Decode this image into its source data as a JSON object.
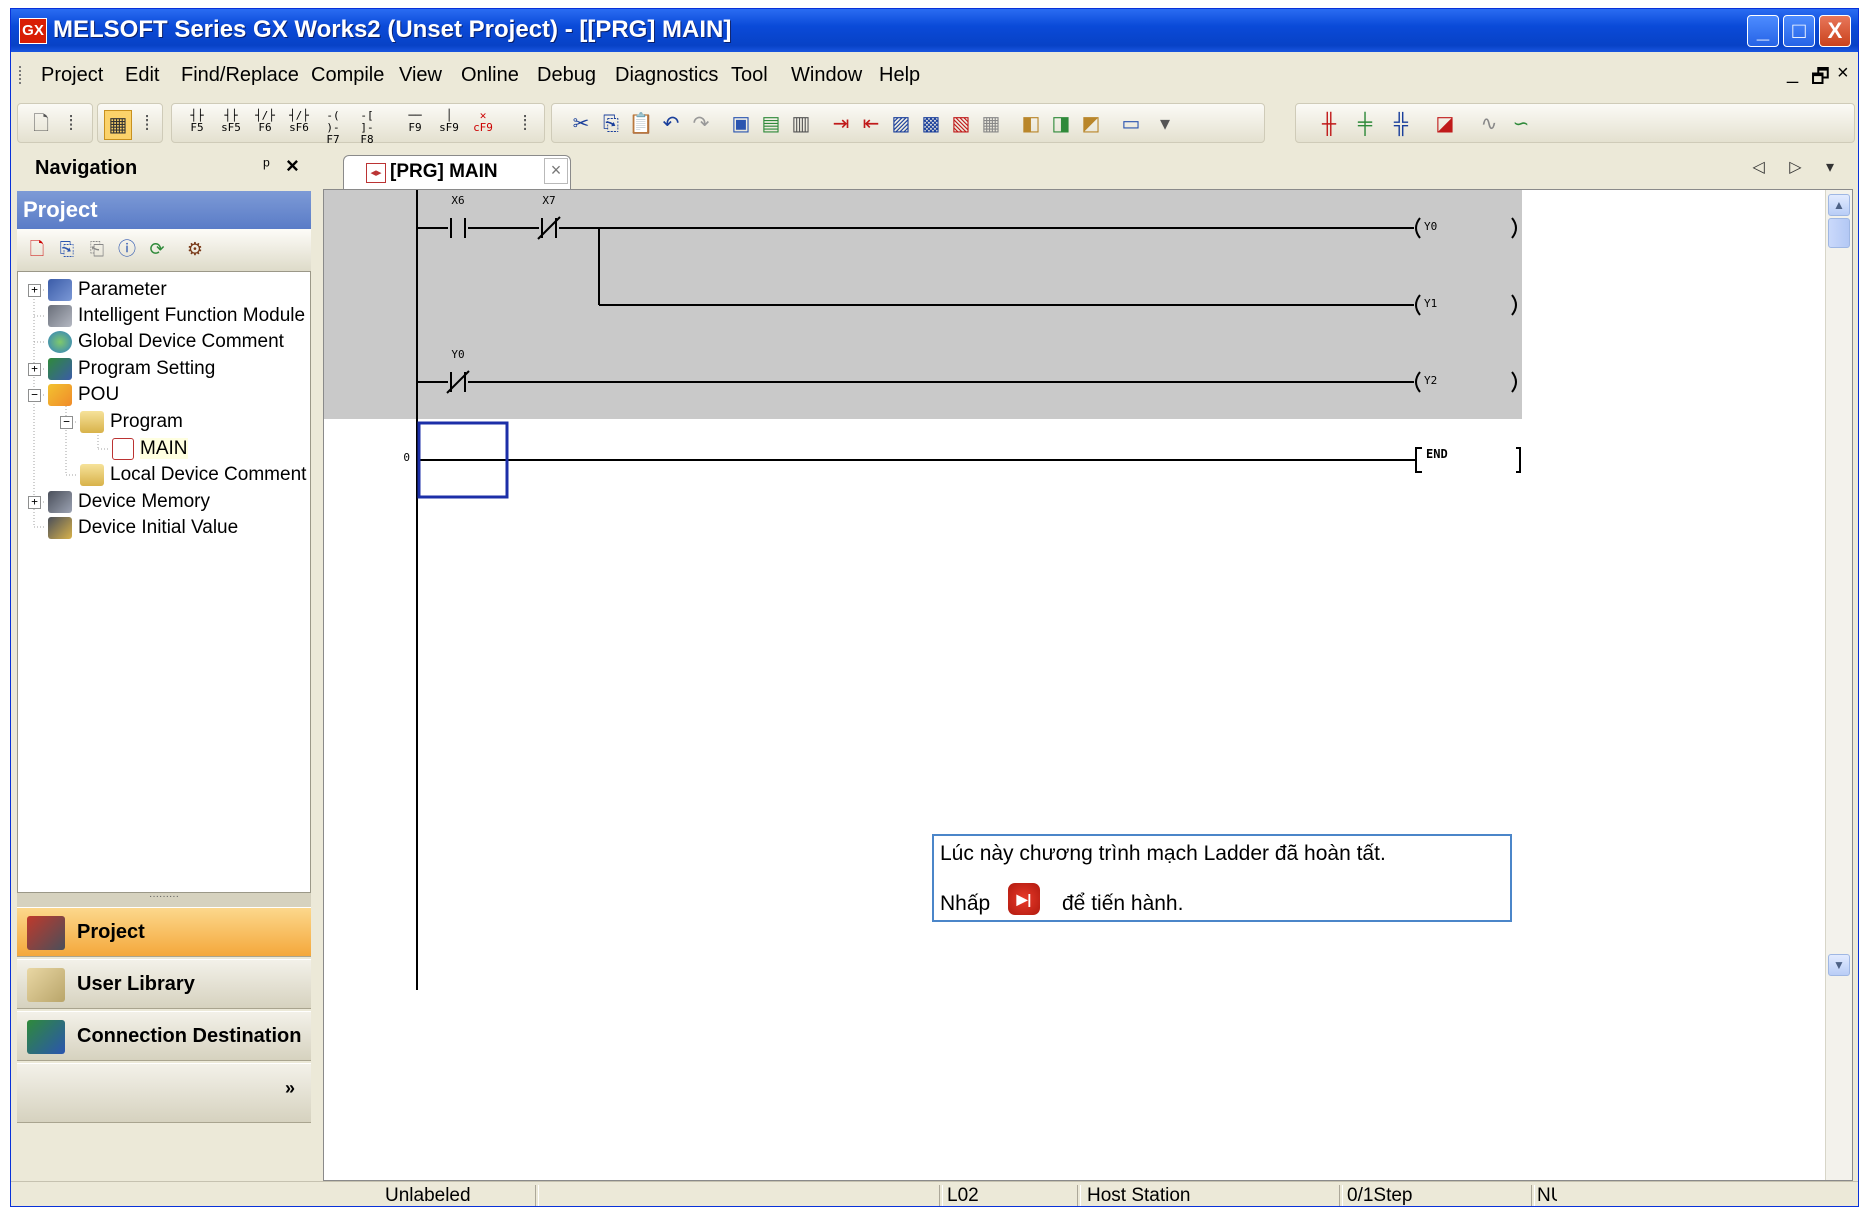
{
  "window": {
    "title": "MELSOFT Series GX Works2 (Unset Project) - [[PRG] MAIN]",
    "app_icon_text": "GX",
    "buttons": {
      "minimize": "_",
      "maximize": "□",
      "close": "X"
    }
  },
  "menu": {
    "items": [
      "Project",
      "Edit",
      "Find/Replace",
      "Compile",
      "View",
      "Online",
      "Debug",
      "Diagnostics",
      "Tool",
      "Window",
      "Help"
    ],
    "mdi": {
      "minimize": "_",
      "restore": "🗗",
      "close": "×"
    }
  },
  "toolbar": {
    "ladder_symbols": [
      "F5",
      "sF5",
      "F6",
      "sF6",
      "F7",
      "F8",
      "F9",
      "sF9",
      "cF9"
    ]
  },
  "navigation": {
    "title": "Navigation",
    "pin": "ᵖ",
    "close": "×",
    "project_header": "Project",
    "tree": [
      {
        "label": "Parameter",
        "expander": "+"
      },
      {
        "label": "Intelligent Function Module"
      },
      {
        "label": "Global Device Comment"
      },
      {
        "label": "Program Setting",
        "expander": "+"
      },
      {
        "label": "POU",
        "expander": "−"
      },
      {
        "label": "Program",
        "expander": "−"
      },
      {
        "label": "MAIN"
      },
      {
        "label": "Local Device Comment"
      },
      {
        "label": "Device Memory",
        "expander": "+"
      },
      {
        "label": "Device Initial Value"
      }
    ],
    "tabs": [
      {
        "label": "Project"
      },
      {
        "label": "User Library"
      },
      {
        "label": "Connection Destination"
      }
    ],
    "more": "»"
  },
  "editor": {
    "tab_label": "[PRG] MAIN",
    "tab_icon": "◂▸",
    "tab_close": "×",
    "tab_nav": "◁ ▷ ▾",
    "ladder": {
      "contacts": [
        {
          "device": "X6",
          "type": "NO"
        },
        {
          "device": "X7",
          "type": "NC"
        },
        {
          "device": "Y0",
          "type": "NC"
        }
      ],
      "coils": [
        "Y0",
        "Y1",
        "Y2"
      ],
      "end_step": "0",
      "end_instruction": "END"
    },
    "scroll": {
      "up": "▲",
      "down": "▼"
    }
  },
  "tooltip": {
    "line1": "Lúc này chương trình mạch Ladder đã hoàn tất.",
    "line2_prefix": "Nhấp",
    "line2_suffix": "để tiến hành.",
    "button_glyph": "▶|"
  },
  "statusbar": {
    "label": "Unlabeled",
    "plc": "L02",
    "station": "Host Station",
    "step": "0/1Step",
    "num": "NUM"
  }
}
